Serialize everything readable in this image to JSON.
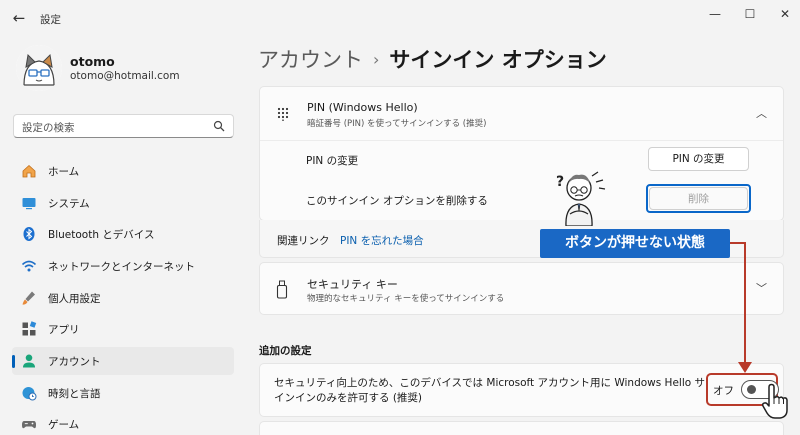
{
  "window": {
    "title": "設定",
    "back": "←",
    "minimize": "—",
    "maximize": "☐",
    "close": "✕"
  },
  "user": {
    "name": "otomo",
    "email": "otomo@hotmail.com"
  },
  "search": {
    "placeholder": "設定の検索"
  },
  "nav": [
    {
      "label": "ホーム",
      "icon": "home-icon",
      "active": false
    },
    {
      "label": "システム",
      "icon": "system-icon",
      "active": false
    },
    {
      "label": "Bluetooth とデバイス",
      "icon": "bluetooth-icon",
      "active": false
    },
    {
      "label": "ネットワークとインターネット",
      "icon": "wifi-icon",
      "active": false
    },
    {
      "label": "個人用設定",
      "icon": "brush-icon",
      "active": false
    },
    {
      "label": "アプリ",
      "icon": "apps-icon",
      "active": false
    },
    {
      "label": "アカウント",
      "icon": "account-icon",
      "active": true
    },
    {
      "label": "時刻と言語",
      "icon": "globe-clock-icon",
      "active": false
    },
    {
      "label": "ゲーム",
      "icon": "gamepad-icon",
      "active": false
    }
  ],
  "header": {
    "breadcrumb": "アカウント",
    "separator": "›",
    "current": "サインイン オプション"
  },
  "pin": {
    "title": "PIN (Windows Hello)",
    "subtitle": "暗証番号 (PIN) を使ってサインインする (推奨)",
    "change_label": "PIN の変更",
    "change_button": "PIN の変更",
    "remove_label": "このサインイン オプションを削除する",
    "remove_button": "削除",
    "related_label": "関連リンク",
    "related_link": "PIN を忘れた場合"
  },
  "security_key": {
    "title": "セキュリティ キー",
    "subtitle": "物理的なセキュリティ キーを使ってサインインする"
  },
  "additional": {
    "section_title": "追加の設定",
    "setting_text": "セキュリティ向上のため、このデバイスでは Microsoft アカウント用に Windows Hello サインインのみを許可する (推奨)",
    "toggle_label": "オフ",
    "toggle_on": false
  },
  "annotation": {
    "callout": "ボタンが押せない状態"
  },
  "colors": {
    "accent": "#005fb8",
    "callout_bg": "#1a68c5",
    "annotation_red": "#b83a2a"
  }
}
